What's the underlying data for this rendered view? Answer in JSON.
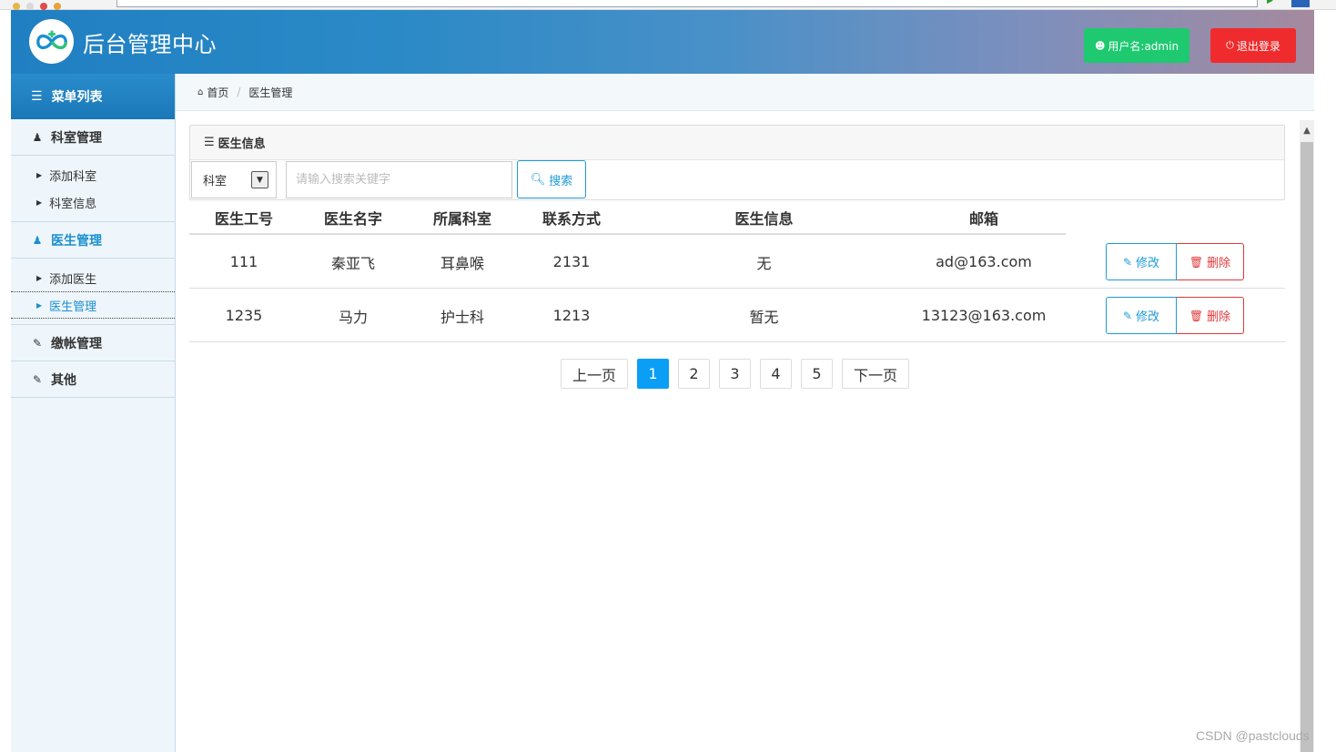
{
  "header": {
    "title": "后台管理中心",
    "user_label": "用户名:admin",
    "logout_label": "退出登录",
    "colors": {
      "user_btn": "#1ec970",
      "logout_btn": "#ef2b2d",
      "accent": "#1a8fd0"
    }
  },
  "sidebar": {
    "heading": "菜单列表",
    "groups": [
      {
        "label": "科室管理",
        "icon": "user-icon",
        "items": [
          "添加科室",
          "科室信息"
        ]
      },
      {
        "label": "医生管理",
        "icon": "user-icon",
        "items": [
          "添加医生",
          "医生管理"
        ],
        "active": true
      },
      {
        "label": "缴帐管理",
        "icon": "edit-icon",
        "items": []
      },
      {
        "label": "其他",
        "icon": "edit-icon",
        "items": []
      }
    ]
  },
  "breadcrumb": {
    "home": "首页",
    "current": "医生管理"
  },
  "panel": {
    "title": "医生信息",
    "select_value": "科室",
    "search_placeholder": "请输入搜索关键字",
    "search_label": "搜索"
  },
  "table": {
    "columns": [
      "医生工号",
      "医生名字",
      "所属科室",
      "联系方式",
      "医生信息",
      "邮箱"
    ],
    "rows": [
      [
        "111",
        "秦亚飞",
        "耳鼻喉",
        "2131",
        "无",
        "ad@163.com"
      ],
      [
        "1235",
        "马力",
        "护士科",
        "1213",
        "暂无",
        "13123@163.com"
      ]
    ],
    "edit_label": "修改",
    "delete_label": "删除"
  },
  "pagination": {
    "prev": "上一页",
    "pages": [
      "1",
      "2",
      "3",
      "4",
      "5"
    ],
    "current": "1",
    "next": "下一页"
  },
  "watermark": "CSDN @pastclouds"
}
